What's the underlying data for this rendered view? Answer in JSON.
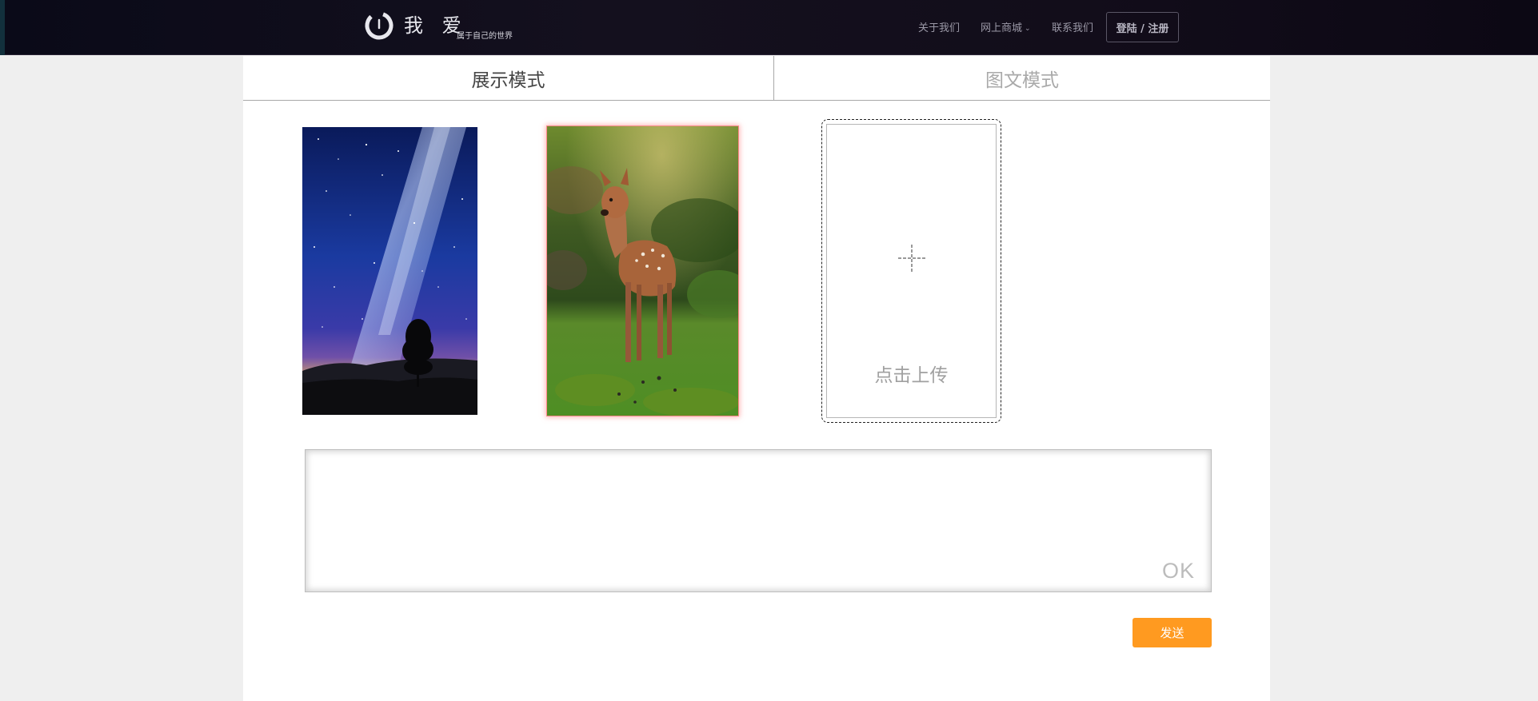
{
  "header": {
    "logo_title": "我 爱",
    "logo_subtitle": "属于自己的世界",
    "nav": {
      "about": "关于我们",
      "shop": "网上商城",
      "contact": "联系我们"
    },
    "login_label": "登陆 / 注册"
  },
  "tabs": {
    "display_mode": "展示模式",
    "image_text_mode": "图文模式"
  },
  "gallery": {
    "upload_label": "点击上传"
  },
  "composer": {
    "placeholder": "",
    "ok_label": "OK",
    "send_label": "发送"
  }
}
